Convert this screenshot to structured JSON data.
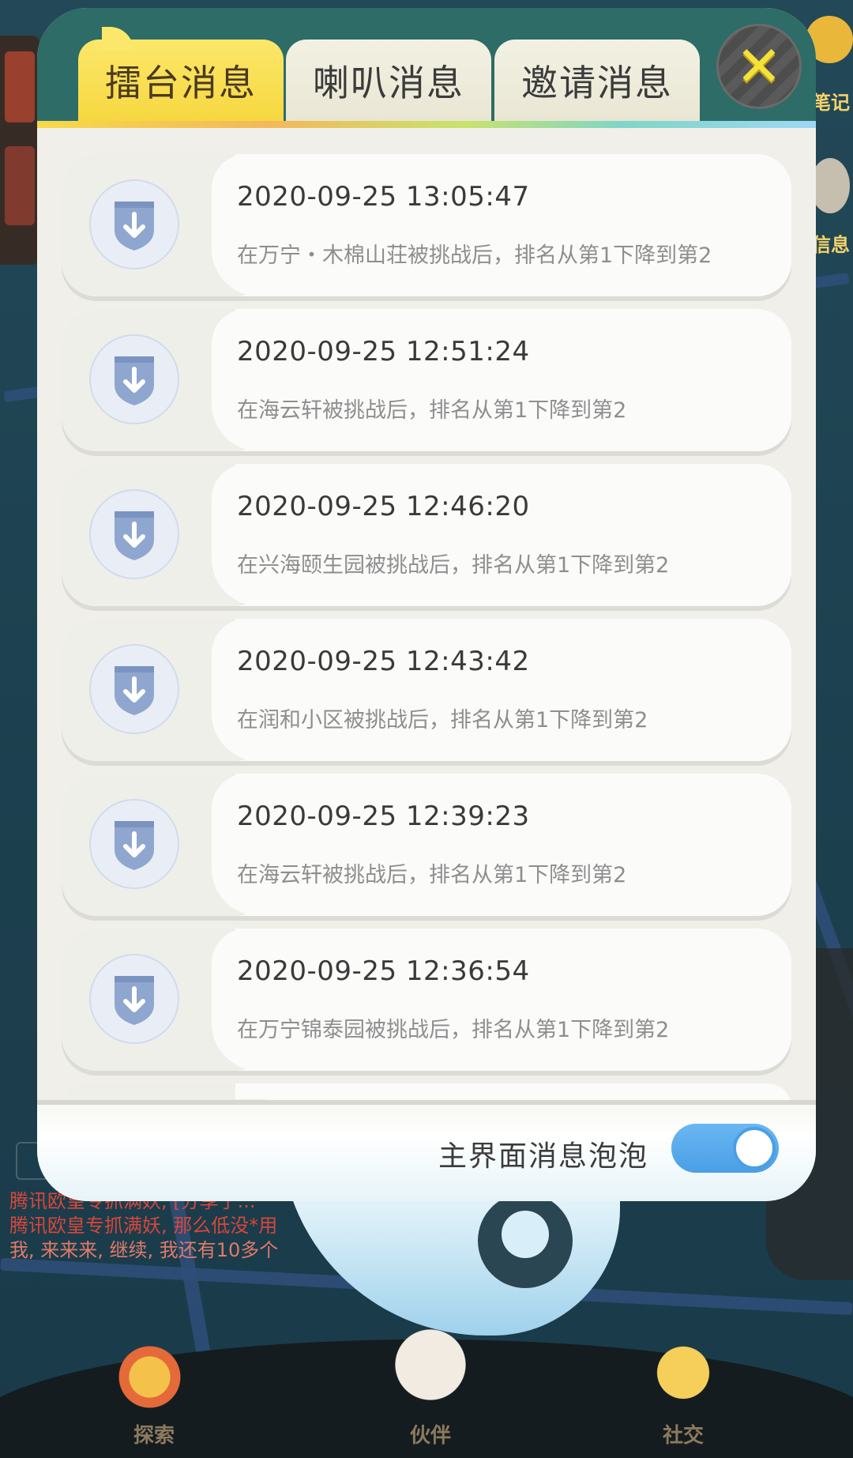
{
  "background": {
    "chat_lines": [
      "腾讯欧皇专抓满妖, [分享了...",
      "腾讯欧皇专抓满妖, 那么低没*用",
      "我, 来来来, 继续, 我还有10多个"
    ],
    "right_top_text": "笔记",
    "right_mid_text": "信息",
    "nav": {
      "explore": "探索",
      "partner": "伙伴",
      "social": "社交"
    }
  },
  "dialog": {
    "tabs": [
      {
        "label": "擂台消息",
        "active": true
      },
      {
        "label": "喇叭消息",
        "active": false
      },
      {
        "label": "邀请消息",
        "active": false
      }
    ],
    "close_icon": "close-x-icon",
    "items": [
      {
        "time": "2020-09-25 13:05:47",
        "text": "在万宁・木棉山荘被挑战后，排名从第1下降到第2",
        "icon": "rank-down-shield-icon"
      },
      {
        "time": "2020-09-25 12:51:24",
        "text": "在海云轩被挑战后，排名从第1下降到第2",
        "icon": "rank-down-shield-icon"
      },
      {
        "time": "2020-09-25 12:46:20",
        "text": "在兴海颐生园被挑战后，排名从第1下降到第2",
        "icon": "rank-down-shield-icon"
      },
      {
        "time": "2020-09-25 12:43:42",
        "text": "在润和小区被挑战后，排名从第1下降到第2",
        "icon": "rank-down-shield-icon"
      },
      {
        "time": "2020-09-25 12:39:23",
        "text": "在海云轩被挑战后，排名从第1下降到第2",
        "icon": "rank-down-shield-icon"
      },
      {
        "time": "2020-09-25 12:36:54",
        "text": "在万宁锦泰园被挑战后，排名从第1下降到第2",
        "icon": "rank-down-shield-icon"
      }
    ],
    "footer": {
      "bubble_label": "主界面消息泡泡",
      "bubble_enabled": true
    },
    "colors": {
      "active_tab": "#f6d63c",
      "header": "#2d6c67",
      "toggle_on": "#4a9fe6",
      "icon": "#8fa6cf"
    }
  }
}
